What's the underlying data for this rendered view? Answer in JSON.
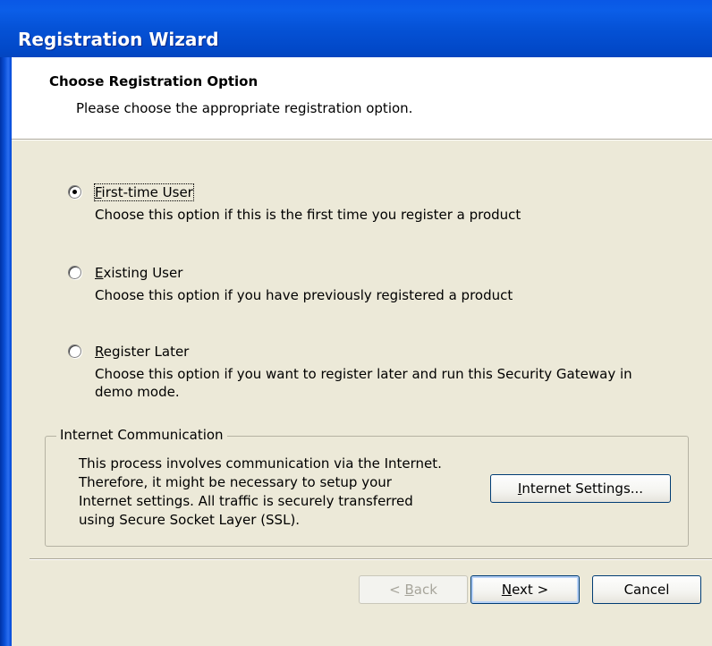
{
  "window": {
    "title": "Registration Wizard"
  },
  "header": {
    "title": "Choose Registration Option",
    "subtitle": "Please choose the appropriate registration option."
  },
  "options": [
    {
      "label_accel": "F",
      "label_rest": "irst-time User",
      "description": "Choose this option if this is the first time you register a product",
      "checked": true
    },
    {
      "label_accel": "E",
      "label_rest": "xisting User",
      "description": "Choose this option if you have previously registered a product",
      "checked": false
    },
    {
      "label_accel": "R",
      "label_rest": "egister Later",
      "description_line1": "Choose this option if you want to register later and run this Security Gateway in",
      "description_line2": "demo mode.",
      "checked": false
    }
  ],
  "internet": {
    "group_title": "Internet Communication",
    "lines": [
      "This process involves communication via the Internet.",
      "Therefore, it might be necessary to setup your",
      "Internet settings. All traffic is securely transferred",
      "using Secure Socket Layer (SSL)."
    ],
    "settings_accel": "I",
    "settings_rest": "nternet Settings..."
  },
  "buttons": {
    "back_prefix": "< ",
    "back_accel": "B",
    "back_rest": "ack",
    "next_accel": "N",
    "next_rest": "ext >",
    "cancel": "Cancel"
  }
}
